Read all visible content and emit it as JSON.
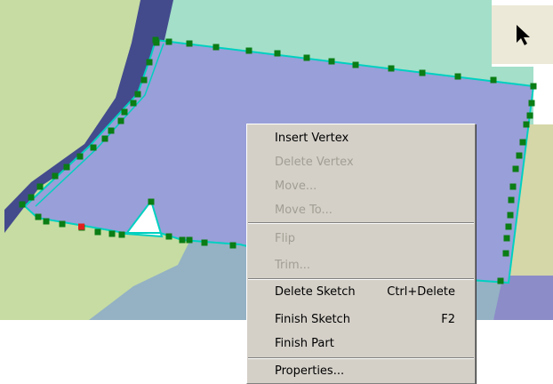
{
  "colors": {
    "green_area": "#c6dca2",
    "mint_area": "#a3dfc9",
    "river": "#434b8d",
    "selected_polygon": "#999fd8",
    "tan_area": "#d5d7a8",
    "blue_gray_area": "#94b2c4",
    "purple_area": "#8c8cc8",
    "sketch_outline": "#00d0c0",
    "vertex": "#0a7d14",
    "active_vertex": "#e0201c",
    "menu_bg": "#d4d0c8",
    "disabled_text": "#a19e94"
  },
  "tool_icon": "arrow-pointer-icon",
  "context_menu": {
    "items": [
      {
        "label": "Insert Vertex",
        "shortcut": "",
        "enabled": true
      },
      {
        "label": "Delete Vertex",
        "shortcut": "",
        "enabled": false
      },
      {
        "label": "Move...",
        "shortcut": "",
        "enabled": false
      },
      {
        "label": "Move To...",
        "shortcut": "",
        "enabled": false
      },
      {
        "label": "Flip",
        "shortcut": "",
        "enabled": false
      },
      {
        "label": "Trim...",
        "shortcut": "",
        "enabled": false
      },
      {
        "label": "Delete Sketch",
        "shortcut": "Ctrl+Delete",
        "enabled": true
      },
      {
        "label": "Finish Sketch",
        "shortcut": "F2",
        "enabled": true
      },
      {
        "label": "Finish Part",
        "shortcut": "",
        "enabled": true
      },
      {
        "label": "Properties...",
        "shortcut": "",
        "enabled": true
      }
    ]
  }
}
